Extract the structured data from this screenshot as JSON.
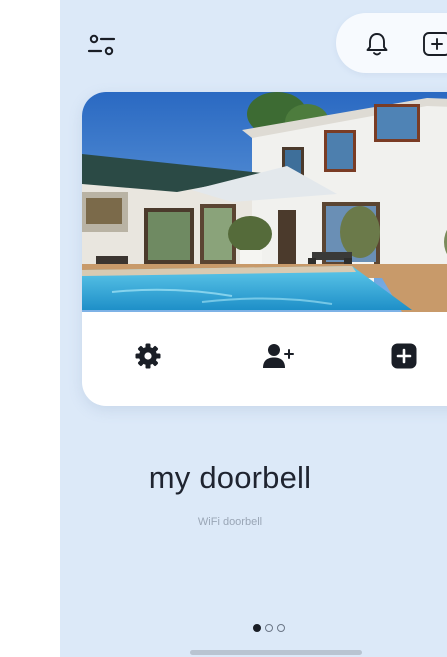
{
  "header": {
    "filter_icon": "sliders-icon",
    "bell_icon": "bell-icon",
    "add_icon": "plus-square-icon"
  },
  "device": {
    "name": "my doorbell",
    "type": "WiFi doorbell",
    "photo": "house-with-pool-photo"
  },
  "card_actions": {
    "settings_icon": "gear-icon",
    "share_icon": "add-user-icon",
    "add_icon": "plus-square-icon"
  },
  "pager": {
    "count": 3,
    "active_index": 0
  },
  "colors": {
    "screen_bg": "#dce9f8",
    "card_bg": "#ffffff",
    "text_primary": "#1f2430",
    "text_secondary": "#9aa6b6",
    "icon_dark": "#1a1e26"
  }
}
